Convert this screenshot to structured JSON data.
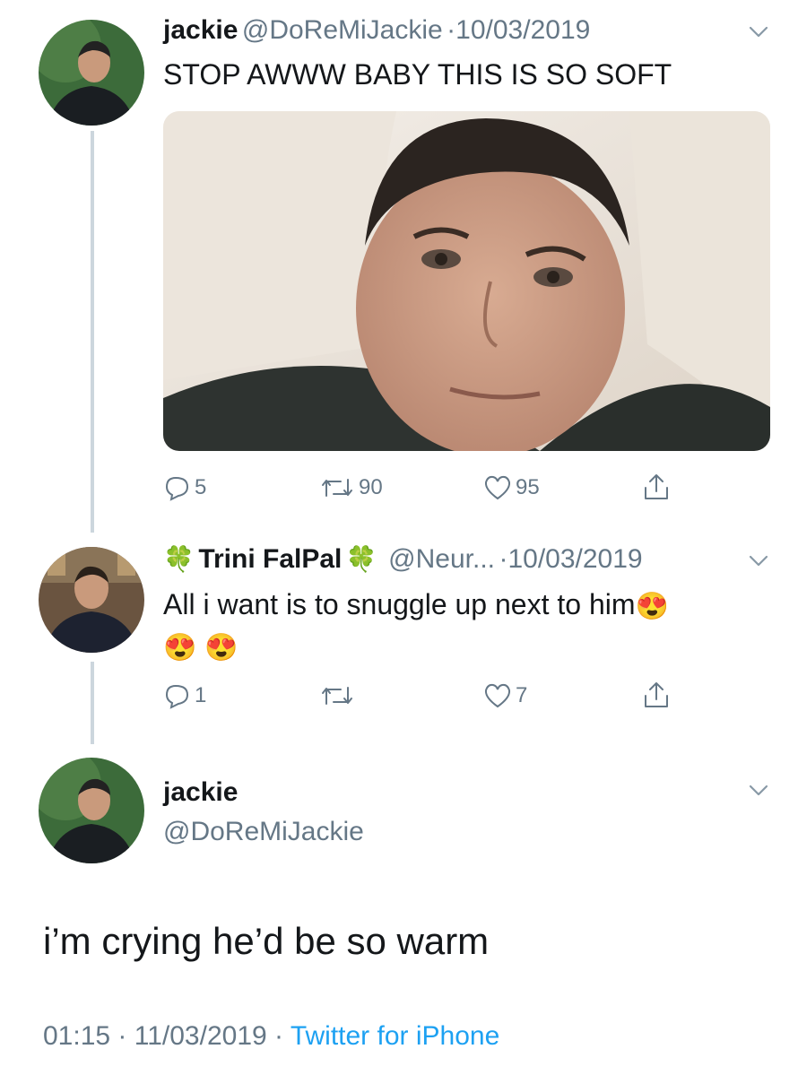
{
  "tweet1": {
    "name": "jackie",
    "handle": "@DoReMiJackie",
    "sep": "·",
    "date": "10/03/2019",
    "text": "STOP AWWW BABY THIS IS SO SOFT",
    "replies": "5",
    "retweets": "90",
    "likes": "95"
  },
  "tweet2": {
    "clover": "🍀",
    "name": "Trini FalPal",
    "handle": "@Neur...",
    "sep": "·",
    "date": "10/03/2019",
    "text": "All i want is to snuggle up next to him",
    "emoji": "😍",
    "replies": "1",
    "likes": "7"
  },
  "tweet3": {
    "name": "jackie",
    "handle": "@DoReMiJackie",
    "text": "i’m crying he’d be so warm",
    "time": "01:15",
    "sep": "·",
    "date": "11/03/2019",
    "client": "Twitter for iPhone"
  },
  "colors": {
    "text": "#14171a",
    "muted": "#657786",
    "link": "#1da1f2",
    "thread_line": "#ccd6dd"
  }
}
